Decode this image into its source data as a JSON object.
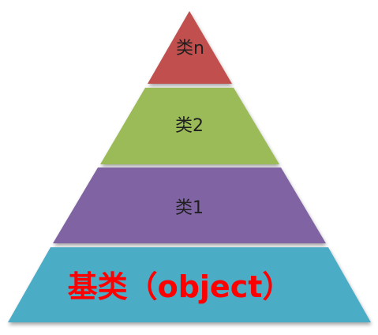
{
  "diagram": {
    "tiers": [
      {
        "label": "类n",
        "color": "#c0504d"
      },
      {
        "label": "类2",
        "color": "#9bbb59"
      },
      {
        "label": "类1",
        "color": "#8064a2"
      },
      {
        "label": "基类（object）",
        "color": "#4bacc6",
        "text_color": "#ff0000"
      }
    ]
  }
}
